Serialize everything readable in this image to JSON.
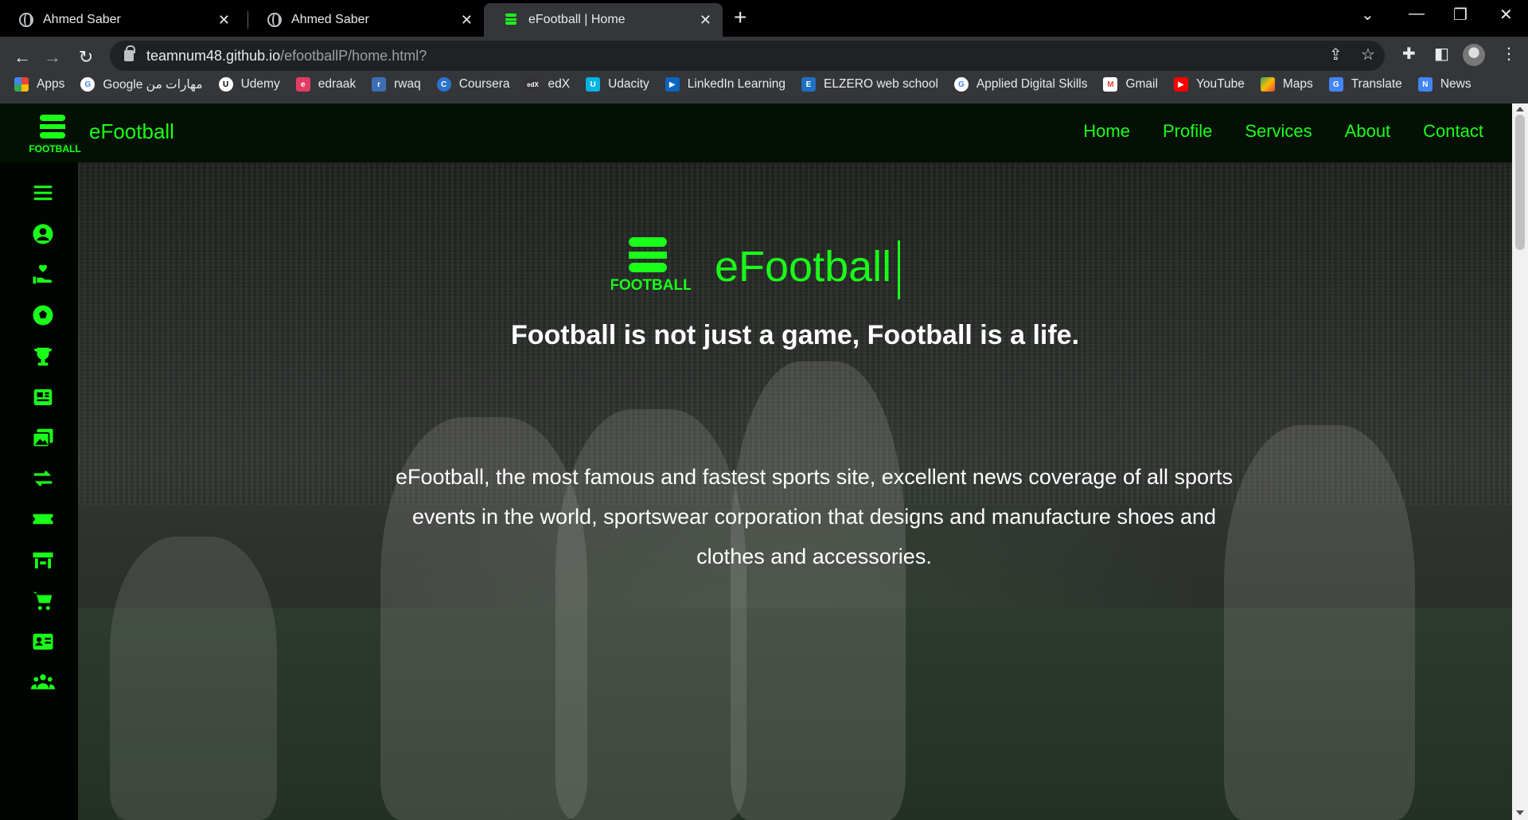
{
  "browser": {
    "tabs": [
      {
        "title": "Ahmed Saber"
      },
      {
        "title": "Ahmed Saber"
      },
      {
        "title": "eFootball | Home"
      }
    ],
    "url_host": "teamnum48.github.io",
    "url_path": "/efootballP/home.html?",
    "bookmarks": [
      {
        "label": "Apps",
        "icon": "apps-grid-icon",
        "color": "#ea4335"
      },
      {
        "label": "Google مهارات من",
        "icon": "google-icon",
        "color": "#4285f4"
      },
      {
        "label": "Udemy",
        "icon": "udemy-icon",
        "color": "#ffffff"
      },
      {
        "label": "edraak",
        "icon": "edraak-icon",
        "color": "#e23c64"
      },
      {
        "label": "rwaq",
        "icon": "rwaq-icon",
        "color": "#3b6fb6"
      },
      {
        "label": "Coursera",
        "icon": "coursera-icon",
        "color": "#2a73cc"
      },
      {
        "label": "edX",
        "icon": "edx-icon",
        "color": "#02262b"
      },
      {
        "label": "Udacity",
        "icon": "udacity-icon",
        "color": "#02b3e4"
      },
      {
        "label": "LinkedIn Learning",
        "icon": "linkedin-learning-icon",
        "color": "#0a66c2"
      },
      {
        "label": "ELZERO web school",
        "icon": "elzero-icon",
        "color": "#1f70c1"
      },
      {
        "label": "Applied Digital Skills",
        "icon": "google-icon",
        "color": "#4285f4"
      },
      {
        "label": "Gmail",
        "icon": "gmail-icon",
        "color": "#ea4335"
      },
      {
        "label": "YouTube",
        "icon": "youtube-icon",
        "color": "#ff0000"
      },
      {
        "label": "Maps",
        "icon": "maps-icon",
        "color": "#34a853"
      },
      {
        "label": "Translate",
        "icon": "translate-icon",
        "color": "#4285f4"
      },
      {
        "label": "News",
        "icon": "news-icon",
        "color": "#4285f4"
      }
    ]
  },
  "site": {
    "brand": "eFootball",
    "logo_text": "FOOTBALL",
    "nav": [
      "Home",
      "Profile",
      "Services",
      "About",
      "Contact"
    ],
    "accent": "#1aff1a",
    "sidebar_icons": [
      "menu-icon",
      "user-icon",
      "donation-icon",
      "football-icon",
      "trophy-icon",
      "newspaper-icon",
      "gallery-icon",
      "transfer-icon",
      "ticket-icon",
      "store-icon",
      "cart-icon",
      "id-card-icon",
      "team-icon"
    ]
  },
  "hero": {
    "title": "eFootball",
    "tagline": "Football is not just a game, Football is a life.",
    "description": "eFootball, the most famous and fastest sports site, excellent news coverage of all sports events in the world, sportswear corporation that designs and manufacture shoes and clothes and accessories."
  }
}
